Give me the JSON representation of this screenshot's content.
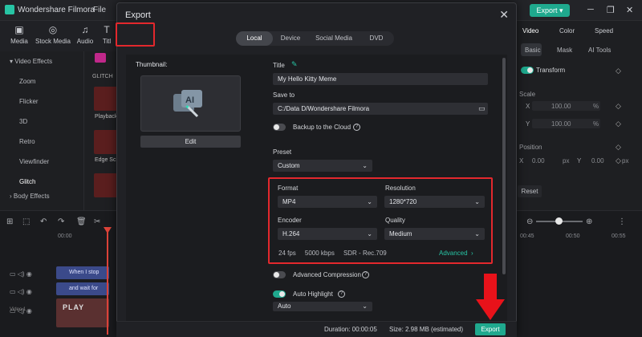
{
  "app": {
    "name": "Wondershare Filmora",
    "menu_file": "File",
    "export_label": "Export"
  },
  "media_toolbar": [
    "Media",
    "Stock Media",
    "Audio",
    "Titl"
  ],
  "left_panel": {
    "section": "Video Effects",
    "items": [
      "Zoom",
      "Flicker",
      "3D",
      "Retro",
      "Viewfinder",
      "Glitch"
    ],
    "footer": "Body Effects",
    "group_label": "GLITCH",
    "thumb_labels": [
      "Playback",
      "Edge Sc"
    ]
  },
  "right_panel": {
    "tabs": [
      "Video",
      "Color",
      "Speed"
    ],
    "subtabs": [
      "Basic",
      "Mask",
      "AI Tools"
    ],
    "transform": "Transform",
    "scale": "Scale",
    "scale_x": "100.00",
    "scale_y": "100.00",
    "pct": "%",
    "position": "Position",
    "pos_x": "0.00",
    "pos_y": "0.00",
    "px": "px",
    "reset": "Reset",
    "x_label": "X",
    "y_label": "Y"
  },
  "timeline": {
    "timecode": "00:00",
    "clip1": "When I stop",
    "clip2": "and wait for",
    "video_label": "Video 1",
    "clip3": "PLAY",
    "ticks": [
      "00:45",
      "00:50",
      "00:55"
    ]
  },
  "dialog": {
    "title": "Export",
    "tabs": [
      "Local",
      "Device",
      "Social Media",
      "DVD"
    ],
    "thumbnail_label": "Thumbnail:",
    "edit_label": "Edit",
    "title_label": "Title",
    "title_value": "My Hello Kitty Meme",
    "save_to_label": "Save to",
    "save_to_value": "C:/Data D/Wondershare Filmora",
    "backup_label": "Backup to the Cloud",
    "preset_label": "Preset",
    "preset_value": "Custom",
    "format_label": "Format",
    "format_value": "MP4",
    "resolution_label": "Resolution",
    "resolution_value": "1280*720",
    "encoder_label": "Encoder",
    "encoder_value": "H.264",
    "quality_label": "Quality",
    "quality_value": "Medium",
    "specs": "24 fps     5000 kbps     SDR - Rec.709",
    "advanced_label": "Advanced",
    "adv_compression_label": "Advanced Compression",
    "auto_highlight_label": "Auto Highlight",
    "auto_value": "Auto",
    "duration": "Duration: 00:00:05",
    "size": "Size: 2.98 MB (estimated)",
    "export_button": "Export"
  },
  "colors": {
    "accent": "#1fa98e",
    "highlight_red": "#e3282d",
    "arrow_red": "#e8121a"
  }
}
